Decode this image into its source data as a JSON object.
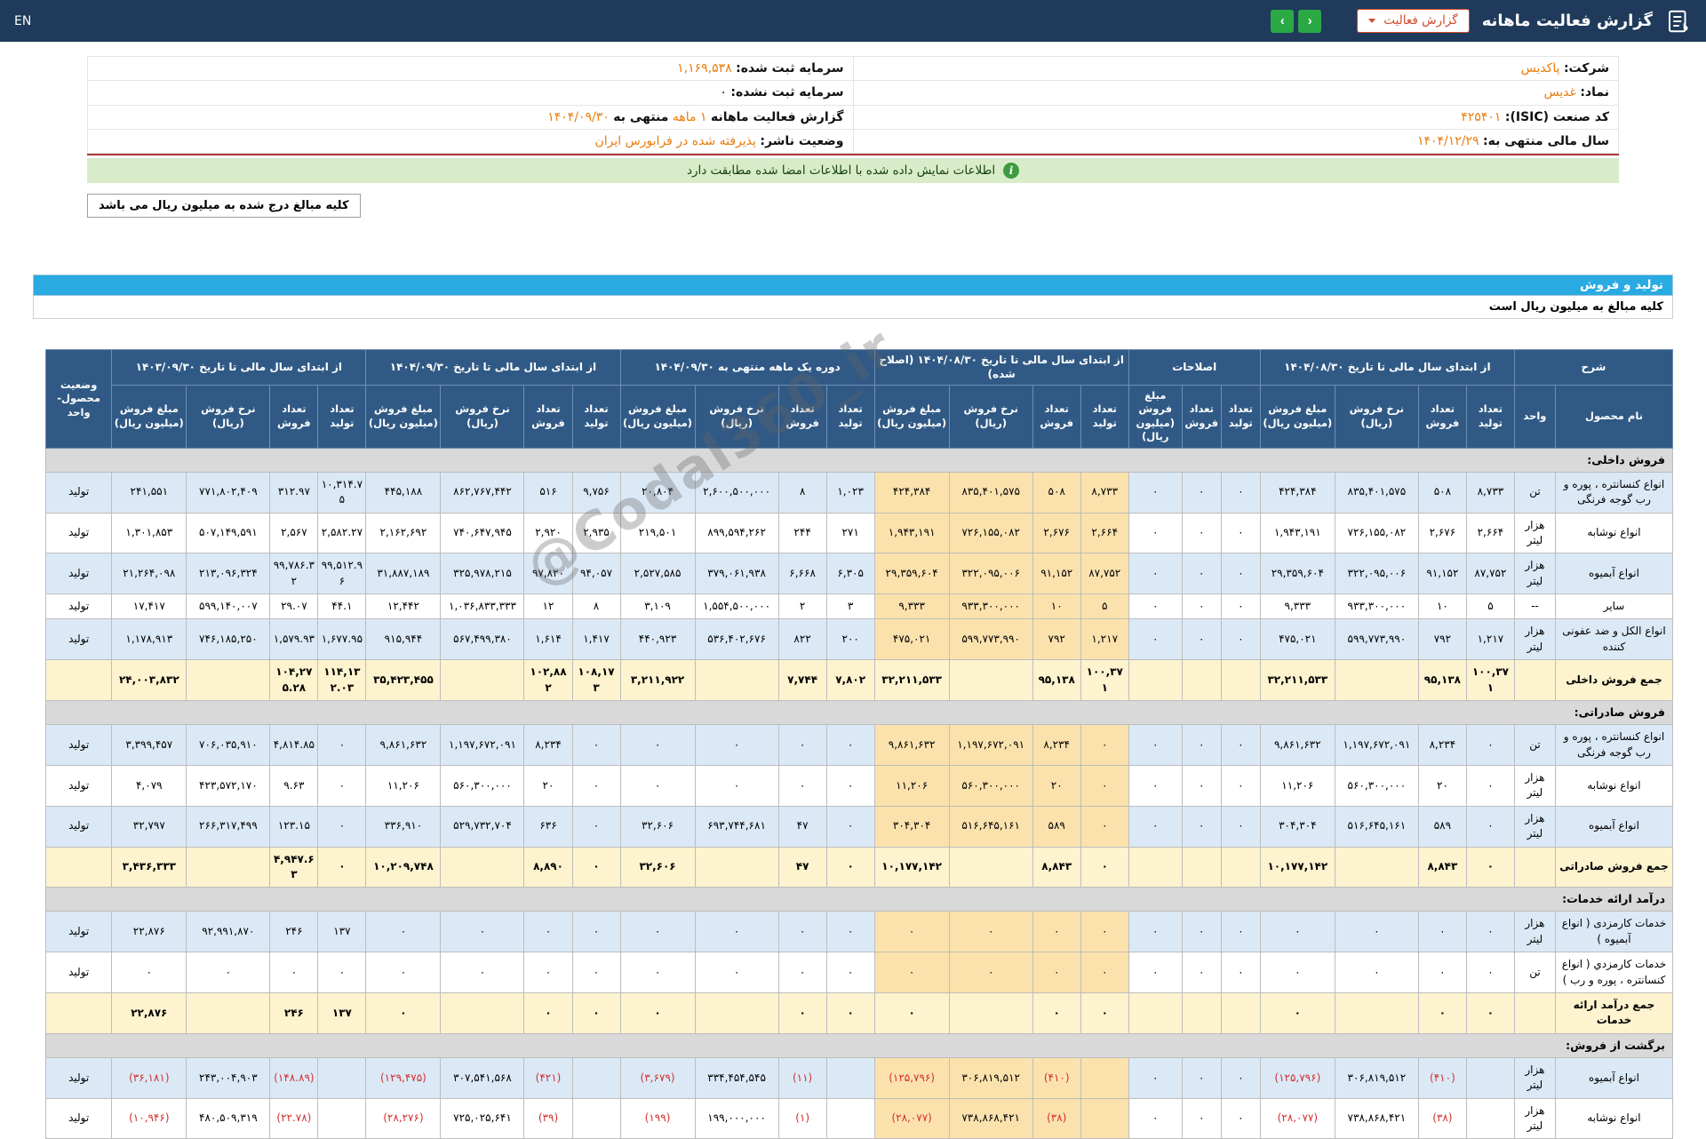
{
  "topbar": {
    "title": "گزارش فعالیت ماهانه",
    "dropdown_label": "گزارش فعالیت",
    "lang_label": "EN",
    "nav_left_glyph": "‹",
    "nav_right_glyph": "›"
  },
  "company_info": {
    "rows": [
      {
        "right": [
          {
            "t": "شرکت:",
            "s": "label"
          },
          {
            "t": "پاکدیس",
            "s": "link"
          }
        ],
        "left": [
          {
            "t": "سرمایه ثبت شده:",
            "s": "label"
          },
          {
            "t": "۱,۱۶۹,۵۳۸",
            "s": "link"
          }
        ]
      },
      {
        "right": [
          {
            "t": "نماد:",
            "s": "label"
          },
          {
            "t": "غدیس",
            "s": "link"
          }
        ],
        "left": [
          {
            "t": "سرمایه ثبت نشده:",
            "s": "label"
          },
          {
            "t": "۰",
            "s": "plain"
          }
        ]
      },
      {
        "right": [
          {
            "t": "کد صنعت (ISIC):",
            "s": "label"
          },
          {
            "t": "۴۲۵۴۰۱",
            "s": "link"
          }
        ],
        "left": [
          {
            "t": "گزارش فعالیت ماهانه",
            "s": "label"
          },
          {
            "t": "۱ ماهه",
            "s": "link"
          },
          {
            "t": "منتهی به",
            "s": "label"
          },
          {
            "t": "۱۴۰۴/۰۹/۳۰",
            "s": "link"
          }
        ]
      },
      {
        "right": [
          {
            "t": "سال مالی منتهی به:",
            "s": "label"
          },
          {
            "t": "۱۴۰۴/۱۲/۲۹",
            "s": "link"
          }
        ],
        "left": [
          {
            "t": "وضعیت ناشر:",
            "s": "label"
          },
          {
            "t": "پذیرفته شده در فرابورس ایران",
            "s": "link"
          }
        ]
      }
    ]
  },
  "signature_banner": "اطلاعات نمایش داده شده با اطلاعات امضا شده مطابقت دارد",
  "amounts_note": "کلیه مبالغ درج شده به میلیون ریال می باشد",
  "section": {
    "title": "تولید و فروش",
    "note": "کلیه مبالغ به میلیون ریال است"
  },
  "watermark": "@Codal360_ir",
  "colors": {
    "topbar_bg": "#1f3a5a",
    "accent_orange": "#e87d0d",
    "section_bar_blue": "#29aae1",
    "table_header_blue": "#305a85",
    "row_blue": "#dbe9f6",
    "adjusted_col_cream": "#fbe2ad",
    "total_row_yellow": "#fdf3cf",
    "section_row_gray": "#d9d9d9",
    "banner_green_bg": "#d9ecc9",
    "nav_green": "#2aa945",
    "negative_red": "#d32f2f",
    "divider_red": "#a93a36"
  },
  "table": {
    "status_header": "وضعیت محصول-واحد",
    "groups": [
      {
        "title": "شرح",
        "cols": [
          "نام محصول",
          "واحد"
        ]
      },
      {
        "title": "از ابتدای سال مالی تا تاریخ ۱۴۰۴/۰۸/۳۰",
        "cols": [
          "تعداد تولید",
          "تعداد فروش",
          "نرخ فروش (ریال)",
          "مبلغ فروش (میلیون ریال)"
        ]
      },
      {
        "title": "اصلاحات",
        "cols": [
          "تعداد تولید",
          "تعداد فروش",
          "مبلغ فروش (میلیون ریال)"
        ]
      },
      {
        "title": "از ابتدای سال مالی تا تاریخ ۱۴۰۴/۰۸/۳۰ (اصلاح شده)",
        "cols": [
          "تعداد تولید",
          "تعداد فروش",
          "نرخ فروش (ریال)",
          "مبلغ فروش (میلیون ریال)"
        ]
      },
      {
        "title": "دوره یک ماهه منتهی به ۱۴۰۴/۰۹/۳۰",
        "cols": [
          "تعداد تولید",
          "تعداد فروش",
          "نرخ فروش (ریال)",
          "مبلغ فروش (میلیون ریال)"
        ]
      },
      {
        "title": "از ابتدای سال مالی تا تاریخ ۱۴۰۴/۰۹/۳۰",
        "cols": [
          "تعداد تولید",
          "تعداد فروش",
          "نرخ فروش (ریال)",
          "مبلغ فروش (میلیون ریال)"
        ]
      },
      {
        "title": "از ابتدای سال مالی تا تاریخ ۱۴۰۳/۰۹/۳۰",
        "cols": [
          "تعداد تولید",
          "تعداد فروش",
          "نرخ فروش (ریال)",
          "مبلغ فروش (میلیون ریال)"
        ]
      }
    ],
    "rows": [
      {
        "type": "section",
        "label": "فروش داخلی:"
      },
      {
        "type": "data",
        "name": "انواع کنسانتره ، پوره و رب گوجه فرنگی",
        "unit": "تن",
        "status": "تولید",
        "ytd_1404_08": [
          "۸,۷۳۳",
          "۵۰۸",
          "۸۳۵,۴۰۱,۵۷۵",
          "۴۲۴,۳۸۴"
        ],
        "adjustments": [
          "۰",
          "۰",
          "۰"
        ],
        "ytd_1404_08_adjusted": [
          "۸,۷۳۳",
          "۵۰۸",
          "۸۳۵,۴۰۱,۵۷۵",
          "۴۲۴,۳۸۴"
        ],
        "month_1404_09": [
          "۱,۰۲۳",
          "۸",
          "۲,۶۰۰,۵۰۰,۰۰۰",
          "۲۰,۸۰۴"
        ],
        "ytd_1404_09": [
          "۹,۷۵۶",
          "۵۱۶",
          "۸۶۲,۷۶۷,۴۴۲",
          "۴۴۵,۱۸۸"
        ],
        "ytd_1403_09": [
          "۱۰,۳۱۴.۷۵",
          "۳۱۲.۹۷",
          "۷۷۱,۸۰۲,۴۰۹",
          "۲۴۱,۵۵۱"
        ]
      },
      {
        "type": "data",
        "name": "انواع نوشابه",
        "unit": "هزار لیتر",
        "status": "تولید",
        "ytd_1404_08": [
          "۲,۶۶۴",
          "۲,۶۷۶",
          "۷۲۶,۱۵۵,۰۸۲",
          "۱,۹۴۳,۱۹۱"
        ],
        "adjustments": [
          "۰",
          "۰",
          "۰"
        ],
        "ytd_1404_08_adjusted": [
          "۲,۶۶۴",
          "۲,۶۷۶",
          "۷۲۶,۱۵۵,۰۸۲",
          "۱,۹۴۳,۱۹۱"
        ],
        "month_1404_09": [
          "۲۷۱",
          "۲۴۴",
          "۸۹۹,۵۹۴,۲۶۲",
          "۲۱۹,۵۰۱"
        ],
        "ytd_1404_09": [
          "۲,۹۳۵",
          "۲,۹۲۰",
          "۷۴۰,۶۴۷,۹۴۵",
          "۲,۱۶۲,۶۹۲"
        ],
        "ytd_1403_09": [
          "۲,۵۸۲.۲۷",
          "۲,۵۶۷",
          "۵۰۷,۱۴۹,۵۹۱",
          "۱,۳۰۱,۸۵۳"
        ]
      },
      {
        "type": "data",
        "name": "انواع آبمیوه",
        "unit": "هزار لیتر",
        "status": "تولید",
        "ytd_1404_08": [
          "۸۷,۷۵۲",
          "۹۱,۱۵۲",
          "۳۲۲,۰۹۵,۰۰۶",
          "۲۹,۳۵۹,۶۰۴"
        ],
        "adjustments": [
          "۰",
          "۰",
          "۰"
        ],
        "ytd_1404_08_adjusted": [
          "۸۷,۷۵۲",
          "۹۱,۱۵۲",
          "۳۲۲,۰۹۵,۰۰۶",
          "۲۹,۳۵۹,۶۰۴"
        ],
        "month_1404_09": [
          "۶,۳۰۵",
          "۶,۶۶۸",
          "۳۷۹,۰۶۱,۹۳۸",
          "۲,۵۲۷,۵۸۵"
        ],
        "ytd_1404_09": [
          "۹۴,۰۵۷",
          "۹۷,۸۲۰",
          "۳۲۵,۹۷۸,۲۱۵",
          "۳۱,۸۸۷,۱۸۹"
        ],
        "ytd_1403_09": [
          "۹۹,۵۱۲.۹۶",
          "۹۹,۷۸۶.۳۲",
          "۲۱۳,۰۹۶,۳۲۴",
          "۲۱,۲۶۴,۰۹۸"
        ]
      },
      {
        "type": "data",
        "name": "سایر",
        "unit": "--",
        "status": "تولید",
        "ytd_1404_08": [
          "۵",
          "۱۰",
          "۹۳۳,۳۰۰,۰۰۰",
          "۹,۳۳۳"
        ],
        "adjustments": [
          "۰",
          "۰",
          "۰"
        ],
        "ytd_1404_08_adjusted": [
          "۵",
          "۱۰",
          "۹۳۳,۳۰۰,۰۰۰",
          "۹,۳۳۳"
        ],
        "month_1404_09": [
          "۳",
          "۲",
          "۱,۵۵۴,۵۰۰,۰۰۰",
          "۳,۱۰۹"
        ],
        "ytd_1404_09": [
          "۸",
          "۱۲",
          "۱,۰۳۶,۸۳۳,۳۳۳",
          "۱۲,۴۴۲"
        ],
        "ytd_1403_09": [
          "۴۴.۱",
          "۲۹.۰۷",
          "۵۹۹,۱۴۰,۰۰۷",
          "۱۷,۴۱۷"
        ]
      },
      {
        "type": "data",
        "name": "انواع الکل و ضد عفونی کننده",
        "unit": "هزار لیتر",
        "status": "تولید",
        "ytd_1404_08": [
          "۱,۲۱۷",
          "۷۹۲",
          "۵۹۹,۷۷۳,۹۹۰",
          "۴۷۵,۰۲۱"
        ],
        "adjustments": [
          "۰",
          "۰",
          "۰"
        ],
        "ytd_1404_08_adjusted": [
          "۱,۲۱۷",
          "۷۹۲",
          "۵۹۹,۷۷۳,۹۹۰",
          "۴۷۵,۰۲۱"
        ],
        "month_1404_09": [
          "۲۰۰",
          "۸۲۲",
          "۵۳۶,۴۰۲,۶۷۶",
          "۴۴۰,۹۲۳"
        ],
        "ytd_1404_09": [
          "۱,۴۱۷",
          "۱,۶۱۴",
          "۵۶۷,۴۹۹,۳۸۰",
          "۹۱۵,۹۴۴"
        ],
        "ytd_1403_09": [
          "۱,۶۷۷.۹۵",
          "۱,۵۷۹.۹۳",
          "۷۴۶,۱۸۵,۲۵۰",
          "۱,۱۷۸,۹۱۳"
        ]
      },
      {
        "type": "total",
        "name": "جمع فروش داخلی",
        "unit": "",
        "status": "",
        "ytd_1404_08": [
          "۱۰۰,۳۷۱",
          "۹۵,۱۳۸",
          "",
          "۳۲,۲۱۱,۵۳۳"
        ],
        "adjustments": [
          "",
          "",
          ""
        ],
        "ytd_1404_08_adjusted": [
          "۱۰۰,۳۷۱",
          "۹۵,۱۳۸",
          "",
          "۳۲,۲۱۱,۵۳۳"
        ],
        "month_1404_09": [
          "۷,۸۰۲",
          "۷,۷۴۴",
          "",
          "۳,۲۱۱,۹۲۲"
        ],
        "ytd_1404_09": [
          "۱۰۸,۱۷۳",
          "۱۰۲,۸۸۲",
          "",
          "۳۵,۴۲۳,۴۵۵"
        ],
        "ytd_1403_09": [
          "۱۱۴,۱۳۲.۰۳",
          "۱۰۴,۲۷۵.۲۸",
          "",
          "۲۴,۰۰۳,۸۳۲"
        ]
      },
      {
        "type": "section",
        "label": "فروش صادراتی:"
      },
      {
        "type": "data",
        "name": "انواع کنسانتره ، پوره و رب گوجه فرنگی",
        "unit": "تن",
        "status": "تولید",
        "ytd_1404_08": [
          "۰",
          "۸,۲۳۴",
          "۱,۱۹۷,۶۷۲,۰۹۱",
          "۹,۸۶۱,۶۳۲"
        ],
        "adjustments": [
          "۰",
          "۰",
          "۰"
        ],
        "ytd_1404_08_adjusted": [
          "۰",
          "۸,۲۳۴",
          "۱,۱۹۷,۶۷۲,۰۹۱",
          "۹,۸۶۱,۶۳۲"
        ],
        "month_1404_09": [
          "۰",
          "۰",
          "۰",
          "۰"
        ],
        "ytd_1404_09": [
          "۰",
          "۸,۲۳۴",
          "۱,۱۹۷,۶۷۲,۰۹۱",
          "۹,۸۶۱,۶۳۲"
        ],
        "ytd_1403_09": [
          "۰",
          "۴,۸۱۴.۸۵",
          "۷۰۶,۰۳۵,۹۱۰",
          "۳,۳۹۹,۴۵۷"
        ]
      },
      {
        "type": "data",
        "name": "انواع نوشابه",
        "unit": "هزار لیتر",
        "status": "تولید",
        "ytd_1404_08": [
          "۰",
          "۲۰",
          "۵۶۰,۳۰۰,۰۰۰",
          "۱۱,۲۰۶"
        ],
        "adjustments": [
          "۰",
          "۰",
          "۰"
        ],
        "ytd_1404_08_adjusted": [
          "۰",
          "۲۰",
          "۵۶۰,۳۰۰,۰۰۰",
          "۱۱,۲۰۶"
        ],
        "month_1404_09": [
          "۰",
          "۰",
          "۰",
          "۰"
        ],
        "ytd_1404_09": [
          "۰",
          "۲۰",
          "۵۶۰,۳۰۰,۰۰۰",
          "۱۱,۲۰۶"
        ],
        "ytd_1403_09": [
          "۰",
          "۹.۶۳",
          "۴۲۳,۵۷۲,۱۷۰",
          "۴,۰۷۹"
        ]
      },
      {
        "type": "data",
        "name": "انواع آبمیوه",
        "unit": "هزار لیتر",
        "status": "تولید",
        "ytd_1404_08": [
          "۰",
          "۵۸۹",
          "۵۱۶,۶۴۵,۱۶۱",
          "۳۰۴,۳۰۴"
        ],
        "adjustments": [
          "۰",
          "۰",
          "۰"
        ],
        "ytd_1404_08_adjusted": [
          "۰",
          "۵۸۹",
          "۵۱۶,۶۴۵,۱۶۱",
          "۳۰۴,۳۰۴"
        ],
        "month_1404_09": [
          "۰",
          "۴۷",
          "۶۹۳,۷۴۴,۶۸۱",
          "۳۲,۶۰۶"
        ],
        "ytd_1404_09": [
          "۰",
          "۶۳۶",
          "۵۲۹,۷۳۲,۷۰۴",
          "۳۳۶,۹۱۰"
        ],
        "ytd_1403_09": [
          "۰",
          "۱۲۳.۱۵",
          "۲۶۶,۳۱۷,۴۹۹",
          "۳۲,۷۹۷"
        ]
      },
      {
        "type": "total",
        "name": "جمع فروش صادراتی",
        "unit": "",
        "status": "",
        "ytd_1404_08": [
          "۰",
          "۸,۸۴۳",
          "",
          "۱۰,۱۷۷,۱۴۲"
        ],
        "adjustments": [
          "",
          "",
          ""
        ],
        "ytd_1404_08_adjusted": [
          "۰",
          "۸,۸۴۳",
          "",
          "۱۰,۱۷۷,۱۴۲"
        ],
        "month_1404_09": [
          "۰",
          "۴۷",
          "",
          "۳۲,۶۰۶"
        ],
        "ytd_1404_09": [
          "۰",
          "۸,۸۹۰",
          "",
          "۱۰,۲۰۹,۷۴۸"
        ],
        "ytd_1403_09": [
          "۰",
          "۴,۹۴۷.۶۳",
          "",
          "۳,۴۳۶,۳۳۳"
        ]
      },
      {
        "type": "section",
        "label": "درآمد ارائه خدمات:"
      },
      {
        "type": "data",
        "name": "خدمات کارمزدی ( انواع آبمیوه )",
        "unit": "هزار لیتر",
        "status": "تولید",
        "ytd_1404_08": [
          "۰",
          "۰",
          "۰",
          "۰"
        ],
        "adjustments": [
          "۰",
          "۰",
          "۰"
        ],
        "ytd_1404_08_adjusted": [
          "۰",
          "۰",
          "۰",
          "۰"
        ],
        "month_1404_09": [
          "۰",
          "۰",
          "۰",
          "۰"
        ],
        "ytd_1404_09": [
          "۰",
          "۰",
          "۰",
          "۰"
        ],
        "ytd_1403_09": [
          "۱۳۷",
          "۲۴۶",
          "۹۲,۹۹۱,۸۷۰",
          "۲۲,۸۷۶"
        ]
      },
      {
        "type": "data",
        "name": "خدمات کارمزدي ( انواع کنسانتره ، پوره و رب )",
        "unit": "تن",
        "status": "تولید",
        "ytd_1404_08": [
          "۰",
          "۰",
          "۰",
          "۰"
        ],
        "adjustments": [
          "۰",
          "۰",
          "۰"
        ],
        "ytd_1404_08_adjusted": [
          "۰",
          "۰",
          "۰",
          "۰"
        ],
        "month_1404_09": [
          "۰",
          "۰",
          "۰",
          "۰"
        ],
        "ytd_1404_09": [
          "۰",
          "۰",
          "۰",
          "۰"
        ],
        "ytd_1403_09": [
          "۰",
          "۰",
          "۰",
          "۰"
        ]
      },
      {
        "type": "total",
        "name": "جمع درآمد ارائه خدمات",
        "unit": "",
        "status": "",
        "ytd_1404_08": [
          "۰",
          "۰",
          "",
          "۰"
        ],
        "adjustments": [
          "",
          "",
          ""
        ],
        "ytd_1404_08_adjusted": [
          "۰",
          "۰",
          "",
          "۰"
        ],
        "month_1404_09": [
          "۰",
          "۰",
          "",
          "۰"
        ],
        "ytd_1404_09": [
          "۰",
          "۰",
          "",
          "۰"
        ],
        "ytd_1403_09": [
          "۱۳۷",
          "۲۴۶",
          "",
          "۲۲,۸۷۶"
        ]
      },
      {
        "type": "section",
        "label": "برگشت از فروش:"
      },
      {
        "type": "data",
        "name": "انواع آبمیوه",
        "unit": "هزار لیتر",
        "status": "تولید",
        "ytd_1404_08": [
          "",
          "(۴۱۰)",
          "۳۰۶,۸۱۹,۵۱۲",
          "(۱۲۵,۷۹۶)"
        ],
        "adjustments": [
          "۰",
          "۰",
          "۰"
        ],
        "ytd_1404_08_adjusted": [
          "",
          "(۴۱۰)",
          "۳۰۶,۸۱۹,۵۱۲",
          "(۱۲۵,۷۹۶)"
        ],
        "month_1404_09": [
          "",
          "(۱۱)",
          "۳۳۴,۴۵۴,۵۴۵",
          "(۳,۶۷۹)"
        ],
        "ytd_1404_09": [
          "",
          "(۴۲۱)",
          "۳۰۷,۵۴۱,۵۶۸",
          "(۱۲۹,۴۷۵)"
        ],
        "ytd_1403_09": [
          "",
          "(۱۴۸.۸۹)",
          "۲۴۳,۰۰۴,۹۰۳",
          "(۳۶,۱۸۱)"
        ]
      },
      {
        "type": "data",
        "name": "انواع نوشابه",
        "unit": "هزار لیتر",
        "status": "تولید",
        "ytd_1404_08": [
          "",
          "(۳۸)",
          "۷۳۸,۸۶۸,۴۲۱",
          "(۲۸,۰۷۷)"
        ],
        "adjustments": [
          "۰",
          "۰",
          "۰"
        ],
        "ytd_1404_08_adjusted": [
          "",
          "(۳۸)",
          "۷۳۸,۸۶۸,۴۲۱",
          "(۲۸,۰۷۷)"
        ],
        "month_1404_09": [
          "",
          "(۱)",
          "۱۹۹,۰۰۰,۰۰۰",
          "(۱۹۹)"
        ],
        "ytd_1404_09": [
          "",
          "(۳۹)",
          "۷۲۵,۰۲۵,۶۴۱",
          "(۲۸,۲۷۶)"
        ],
        "ytd_1403_09": [
          "",
          "(۲۲.۷۸)",
          "۴۸۰,۵۰۹,۳۱۹",
          "(۱۰,۹۴۶)"
        ]
      }
    ]
  }
}
